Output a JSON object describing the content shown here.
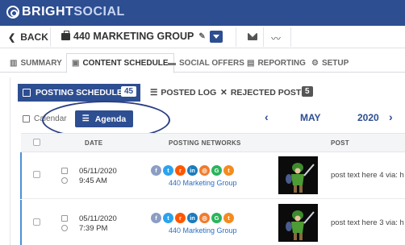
{
  "brand": {
    "part1": "BRIGHT",
    "part2": "SOCIAL"
  },
  "subbar": {
    "back_label": "BACK",
    "group_name": "440 MARKETING GROUP"
  },
  "tabs": [
    {
      "label": "SUMMARY",
      "icon": "bar-chart-icon"
    },
    {
      "label": "CONTENT SCHEDULE",
      "icon": "calendar-icon",
      "active": true
    },
    {
      "label": "SOCIAL OFFERS",
      "icon": "ticket-icon"
    },
    {
      "label": "REPORTING",
      "icon": "document-icon"
    },
    {
      "label": "SETUP",
      "icon": "gear-icon"
    }
  ],
  "schedule_tabs": {
    "posting_schedule": {
      "label": "POSTING SCHEDULE",
      "count": "45"
    },
    "posted_log": {
      "label": "POSTED LOG"
    },
    "rejected_posts": {
      "label": "REJECTED POSTS",
      "count": "5"
    }
  },
  "view_toggle": {
    "calendar_label": "Calendar",
    "agenda_label": "Agenda",
    "selected": "Agenda"
  },
  "month_nav": {
    "prev": "‹",
    "month": "MAY",
    "year": "2020",
    "next": "›"
  },
  "table": {
    "headers": {
      "date": "DATE",
      "networks": "POSTING NETWORKS",
      "post": "POST"
    },
    "rows": [
      {
        "date": "05/11/2020",
        "time": "9:45 AM",
        "group": "440 Marketing Group",
        "post": "post text here 4 via: h"
      },
      {
        "date": "05/11/2020",
        "time": "7:39 PM",
        "group": "440 Marketing Group",
        "post": "post text here 3 via: h"
      }
    ]
  },
  "network_icons": [
    {
      "name": "facebook-icon",
      "glyph": "f"
    },
    {
      "name": "twitter-icon",
      "glyph": "t"
    },
    {
      "name": "reddit-icon",
      "glyph": "r"
    },
    {
      "name": "linkedin-icon",
      "glyph": "in"
    },
    {
      "name": "instagram-icon",
      "glyph": "◎"
    },
    {
      "name": "google-business-icon",
      "glyph": "G"
    },
    {
      "name": "tumblr-icon",
      "glyph": "t"
    }
  ],
  "colors": {
    "brand_blue": "#2d4e91",
    "link_blue": "#2d6fc2",
    "annotation_ellipse": "#2a3f84"
  }
}
